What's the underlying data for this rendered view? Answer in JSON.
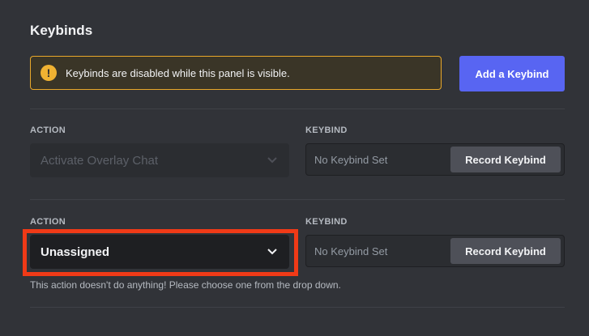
{
  "title": "Keybinds",
  "warning": {
    "icon": "!",
    "text": "Keybinds are disabled while this panel is visible."
  },
  "add_button_label": "Add a Keybind",
  "rows": [
    {
      "action_label": "ACTION",
      "action_value": "Activate Overlay Chat",
      "keybind_label": "KEYBIND",
      "keybind_value": "No Keybind Set",
      "record_label": "Record Keybind",
      "disabled": true
    },
    {
      "action_label": "ACTION",
      "action_value": "Unassigned",
      "keybind_label": "KEYBIND",
      "keybind_value": "No Keybind Set",
      "record_label": "Record Keybind",
      "help": "This action doesn't do anything! Please choose one from the drop down."
    }
  ],
  "colors": {
    "background": "#313338",
    "accent": "#5865f2",
    "warning_border": "#e9a82a",
    "highlight": "#f03a17"
  },
  "icons": [
    "warning-icon",
    "chevron-down-icon"
  ]
}
